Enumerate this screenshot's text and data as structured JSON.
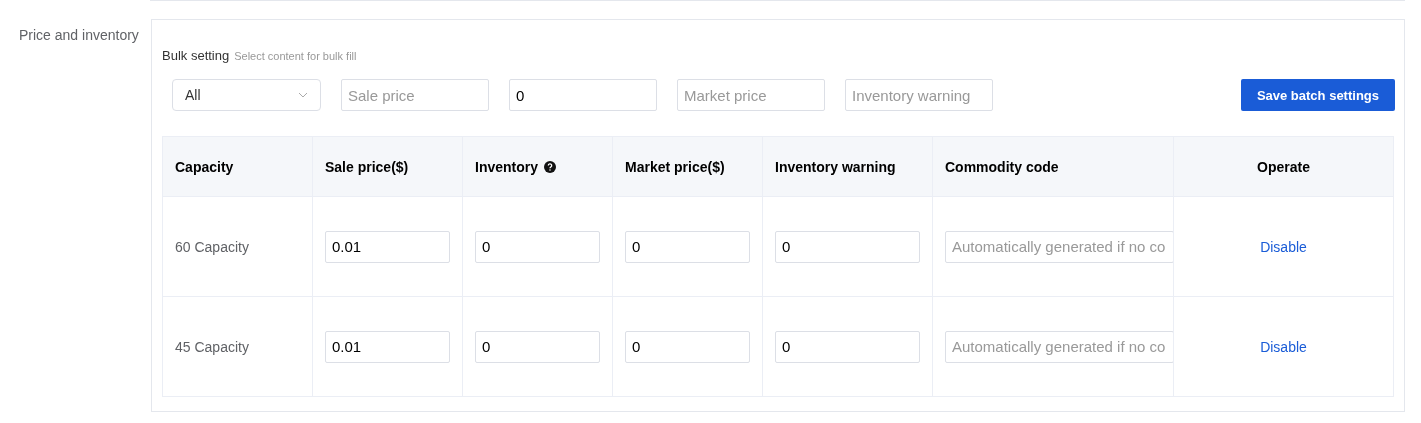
{
  "section": {
    "label": "Price and inventory"
  },
  "bulk_setting": {
    "title": "Bulk setting",
    "hint": "Select content for bulk fill",
    "fields": [
      {
        "kind": "select",
        "value": "All"
      },
      {
        "kind": "input",
        "placeholder": "Sale price"
      },
      {
        "kind": "input",
        "value": "0"
      },
      {
        "kind": "input",
        "placeholder": "Market price"
      },
      {
        "kind": "input",
        "placeholder": "Inventory warning"
      }
    ],
    "save_button": "Save batch settings"
  },
  "table": {
    "columns": [
      {
        "label": "Capacity",
        "help": false
      },
      {
        "label": "Sale price($)",
        "help": false
      },
      {
        "label": "Inventory",
        "help": true
      },
      {
        "label": "Market price($)",
        "help": false
      },
      {
        "label": "Inventory warning",
        "help": false
      },
      {
        "label": "Commodity code",
        "help": false
      },
      {
        "label": "Operate",
        "help": false
      }
    ],
    "rows": [
      {
        "cells": [
          {
            "kind": "text",
            "text": "60 Capacity"
          },
          {
            "kind": "input",
            "value": "0.01"
          },
          {
            "kind": "input",
            "value": "0"
          },
          {
            "kind": "input",
            "value": "0"
          },
          {
            "kind": "input",
            "value": "0"
          },
          {
            "kind": "input",
            "placeholder": "Automatically generated if no co"
          },
          {
            "kind": "link",
            "text": "Disable"
          }
        ]
      },
      {
        "cells": [
          {
            "kind": "text",
            "text": "45 Capacity"
          },
          {
            "kind": "input",
            "value": "0.01"
          },
          {
            "kind": "input",
            "value": "0"
          },
          {
            "kind": "input",
            "value": "0"
          },
          {
            "kind": "input",
            "value": "0"
          },
          {
            "kind": "input",
            "placeholder": "Automatically generated if no co"
          },
          {
            "kind": "link",
            "text": "Disable"
          }
        ]
      }
    ]
  }
}
